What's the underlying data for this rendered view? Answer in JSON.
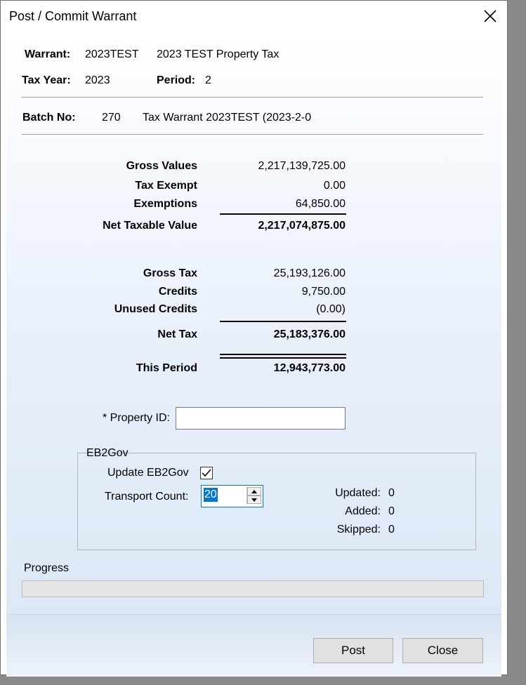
{
  "window": {
    "title": "Post / Commit Warrant"
  },
  "header": {
    "warrant_label": "Warrant:",
    "warrant_value": "2023TEST",
    "warrant_desc": "2023 TEST Property Tax",
    "tax_year_label": "Tax Year:",
    "tax_year_value": "2023",
    "period_label": "Period:",
    "period_value": "2",
    "batch_label": "Batch No:",
    "batch_value": "270",
    "batch_desc": "Tax Warrant 2023TEST (2023-2-0"
  },
  "values": {
    "gross_values_label": "Gross Values",
    "gross_values": "2,217,139,725.00",
    "tax_exempt_label": "Tax Exempt",
    "tax_exempt": "0.00",
    "exemptions_label": "Exemptions",
    "exemptions": "64,850.00",
    "net_taxable_label": "Net Taxable Value",
    "net_taxable": "2,217,074,875.00"
  },
  "tax": {
    "gross_tax_label": "Gross Tax",
    "gross_tax": "25,193,126.00",
    "credits_label": "Credits",
    "credits": "9,750.00",
    "unused_credits_label": "Unused Credits",
    "unused_credits": "(0.00)",
    "net_tax_label": "Net Tax",
    "net_tax": "25,183,376.00",
    "this_period_label": "This Period",
    "this_period": "12,943,773.00"
  },
  "property": {
    "label": "* Property ID:",
    "value": ""
  },
  "eb2gov": {
    "group_label": "EB2Gov",
    "update_label": "Update EB2Gov",
    "update_checked": true,
    "transport_label": "Transport Count:",
    "transport_value": "20",
    "updated_label": "Updated:",
    "updated_value": "0",
    "added_label": "Added:",
    "added_value": "0",
    "skipped_label": "Skipped:",
    "skipped_value": "0"
  },
  "progress": {
    "label": "Progress",
    "percent": 0
  },
  "buttons": {
    "post": "Post",
    "close": "Close"
  }
}
